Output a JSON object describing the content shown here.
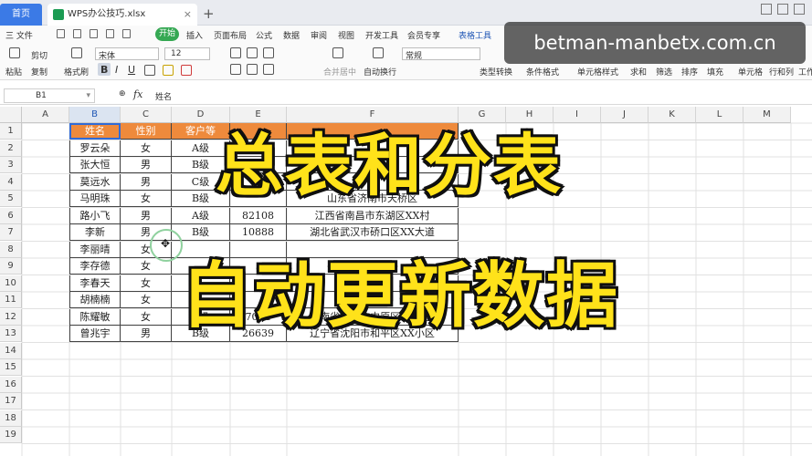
{
  "titlebar": {
    "home_tab": "首页",
    "file_tab": "WPS办公技巧.xlsx",
    "close_glyph": "×",
    "new_tab_glyph": "+"
  },
  "menu": {
    "file": "三 文件",
    "start": "开始",
    "items": [
      "插入",
      "页面布局",
      "公式",
      "数据",
      "审阅",
      "视图",
      "开发工具",
      "会员专享",
      "表格工具"
    ]
  },
  "ribbon": {
    "paste": "粘贴",
    "cut": "剪切",
    "copy": "复制",
    "format_painter": "格式刷",
    "font_name": "宋体",
    "font_size": "12",
    "bold": "B",
    "italic": "I",
    "underline": "U",
    "merge": "合并居中",
    "wrap": "自动换行",
    "number_format": "常规",
    "type_convert": "类型转换",
    "cond_format": "条件格式",
    "cell_style": "单元格样式",
    "sum": "求和",
    "filter": "筛选",
    "sort": "排序",
    "fill": "填充",
    "cell": "单元格",
    "row_col": "行和列",
    "worksheet": "工作"
  },
  "watermark": "betman-manbetx.com.cn",
  "formula_bar": {
    "cell_ref": "B1",
    "fx": "fx",
    "value": "姓名"
  },
  "columns": [
    "A",
    "B",
    "C",
    "D",
    "E",
    "F",
    "G",
    "H",
    "I",
    "J",
    "K",
    "L",
    "M"
  ],
  "rows": [
    "1",
    "2",
    "3",
    "4",
    "5",
    "6",
    "7",
    "8",
    "9",
    "10",
    "11",
    "12",
    "13",
    "14",
    "15",
    "16",
    "17",
    "18",
    "19"
  ],
  "table": {
    "headers": [
      "姓名",
      "性别",
      "客户等"
    ],
    "rows": [
      [
        "罗云朵",
        "女",
        "A级",
        "",
        ""
      ],
      [
        "张大恒",
        "男",
        "B级",
        "",
        ""
      ],
      [
        "莫远水",
        "男",
        "C级",
        "",
        ""
      ],
      [
        "马明珠",
        "女",
        "B级",
        "",
        "山东省济南市天桥区"
      ],
      [
        "路小飞",
        "男",
        "A级",
        "82108",
        "江西省南昌市东湖区XX村"
      ],
      [
        "李新",
        "男",
        "B级",
        "10888",
        "湖北省武汉市硚口区XX大道"
      ],
      [
        "李丽晴",
        "女",
        "",
        "",
        ""
      ],
      [
        "李存德",
        "女",
        "",
        "",
        ""
      ],
      [
        "李春天",
        "女",
        "",
        "",
        ""
      ],
      [
        "胡楠楠",
        "女",
        "",
        "",
        ""
      ],
      [
        "陈耀敏",
        "女",
        "B级",
        "7004",
        "河南省郑州市中原区XX小区"
      ],
      [
        "曾兆宇",
        "男",
        "B级",
        "26639",
        "辽宁省沈阳市和平区XX小区"
      ]
    ]
  },
  "overlay": {
    "line1": "总表和分表",
    "line2": "自动更新数据"
  },
  "colors": {
    "header_orange": "#ee8a3c",
    "banner_yellow": "#ffe21a",
    "accent_blue": "#3b7ae6",
    "start_green": "#35a853"
  }
}
